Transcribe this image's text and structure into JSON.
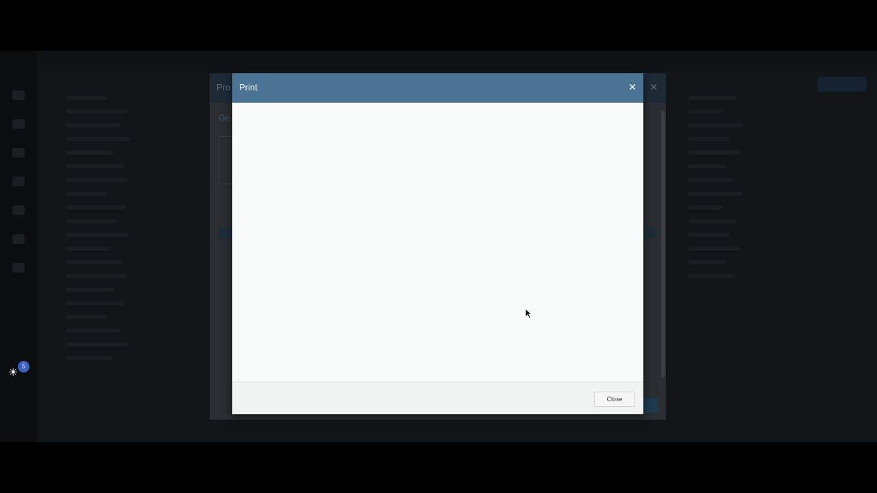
{
  "print_dialog": {
    "title": "Print",
    "close_icon": "✕",
    "close_button_label": "Close"
  },
  "background_modal": {
    "title": "Pro",
    "subtitle": "Ge",
    "close_icon": "✕"
  },
  "help_widget": {
    "icon": "lightbulb-icon",
    "badge_count": "5"
  },
  "colors": {
    "dialog_header": "#4b7393",
    "badge": "#3d5fc4"
  }
}
